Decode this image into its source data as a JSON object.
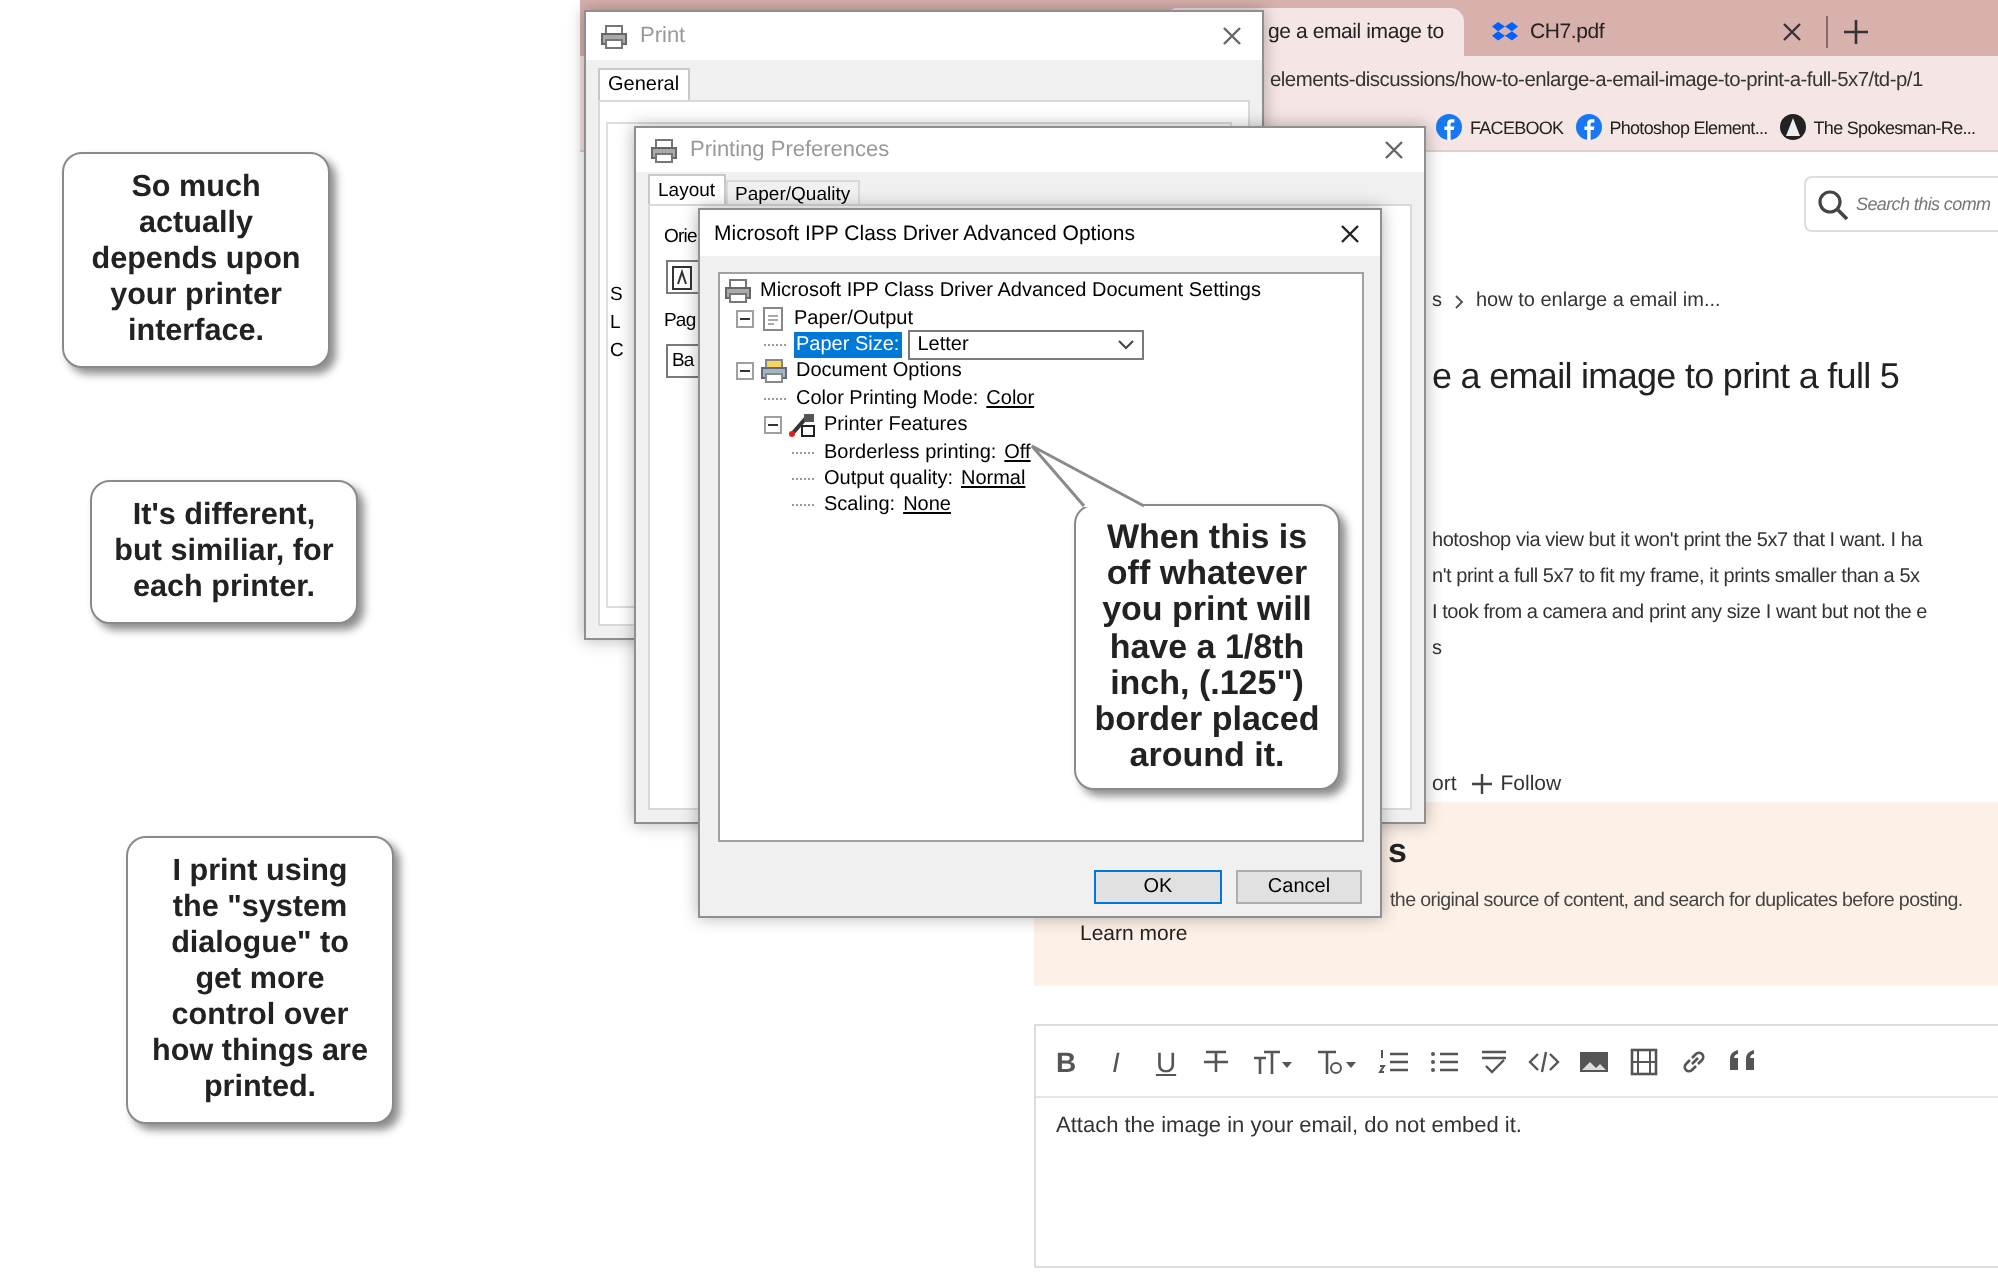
{
  "callouts": [
    {
      "kind": "plain",
      "text": "So much actually depends upon your printer interface."
    },
    {
      "kind": "plain",
      "text": "It's different, but similiar, for each printer."
    },
    {
      "kind": "plain",
      "text": "I print using the \"system dialogue\" to get more control over how things are printed."
    },
    {
      "kind": "pointed",
      "text": "When this is off whatever you print will have a 1/8th inch, (.125\") border placed around it."
    }
  ],
  "browser": {
    "tabs": [
      {
        "kind": "page",
        "label": "ge a email image to",
        "selected": true
      },
      {
        "kind": "document",
        "label": "CH7.pdf",
        "selected": false
      }
    ],
    "address": "elements-discussions/how-to-enlarge-a-email-image-to-print-a-full-5x7/td-p/1",
    "bookmarks": [
      {
        "kind": "social",
        "label": "FACEBOOK"
      },
      {
        "kind": "social",
        "label": "Photoshop Element..."
      },
      {
        "kind": "news",
        "label": "The Spokesman-Re..."
      }
    ],
    "search": {
      "placeholder": "Search this comm"
    },
    "breadcrumb": [
      "s",
      "how to enlarge a email im..."
    ],
    "title": "e a email image to print a full 5",
    "body": [
      "hotoshop via view but it won't print the 5x7 that I want.  I ha",
      "n't print a full 5x7 to fit my frame, it prints smaller than a 5x",
      "I took from a camera and print any size I want but not the e",
      "s"
    ],
    "actions": [
      {
        "kind": "link",
        "label": "ort"
      },
      {
        "kind": "follow",
        "label": "Follow"
      }
    ],
    "notice": {
      "heading": "s",
      "text": "the original source of content, and search for duplicates before posting.",
      "link": "Learn more"
    },
    "editor": {
      "toolbar": [
        {
          "kind": "bold",
          "label": "B"
        },
        {
          "kind": "italic",
          "label": "I"
        },
        {
          "kind": "underline",
          "label": "U"
        },
        {
          "kind": "strikethrough"
        },
        {
          "kind": "font-size"
        },
        {
          "kind": "text-style"
        },
        {
          "kind": "numbered-list"
        },
        {
          "kind": "bulleted-list"
        },
        {
          "kind": "spellcheck"
        },
        {
          "kind": "code"
        },
        {
          "kind": "image"
        },
        {
          "kind": "media"
        },
        {
          "kind": "link"
        },
        {
          "kind": "quote"
        }
      ],
      "value": "Attach the image in your email, do not embed it."
    }
  },
  "print_dialog": {
    "title": "Print",
    "tabs": [
      {
        "label": "General",
        "selected": true
      }
    ],
    "labels": [
      "S",
      "L",
      "C"
    ]
  },
  "preferences_dialog": {
    "title": "Printing Preferences",
    "tabs": [
      {
        "label": "Layout",
        "selected": true
      },
      {
        "label": "Paper/Quality",
        "selected": false
      }
    ],
    "labels": [
      "Orie",
      "Pag"
    ],
    "combo": "Ba"
  },
  "advanced_dialog": {
    "title": "Microsoft IPP Class Driver Advanced Options",
    "tree": {
      "kind": "root",
      "label": "Microsoft IPP Class Driver Advanced Document Settings",
      "selected": false,
      "children": [
        {
          "kind": "paper",
          "label": "Paper/Output",
          "expanded": true,
          "selected": false,
          "children": [
            {
              "kind": "dropdown",
              "label": "Paper Size:",
              "value": "Letter",
              "selected": true
            }
          ]
        },
        {
          "kind": "options",
          "label": "Document Options",
          "expanded": true,
          "selected": false,
          "children": [
            {
              "kind": "link",
              "label": "Color Printing Mode:",
              "value": "Color",
              "selected": false
            },
            {
              "kind": "features",
              "label": "Printer Features",
              "expanded": true,
              "selected": false,
              "children": [
                {
                  "kind": "link",
                  "label": "Borderless printing:",
                  "value": "Off",
                  "selected": false
                },
                {
                  "kind": "link",
                  "label": "Output quality:",
                  "value": "Normal",
                  "selected": false
                },
                {
                  "kind": "link",
                  "label": "Scaling:",
                  "value": "None",
                  "selected": false
                }
              ]
            }
          ]
        }
      ]
    },
    "buttons": [
      {
        "label": "OK",
        "default": true
      },
      {
        "label": "Cancel",
        "default": false
      }
    ]
  }
}
